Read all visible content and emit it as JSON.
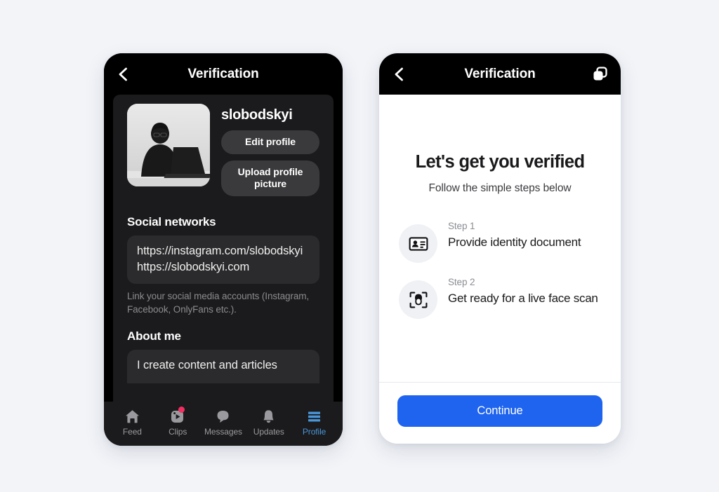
{
  "canvas": {
    "background_color": "#f2f4f8"
  },
  "profile_screen": {
    "name": "profile-verification-screen",
    "topbar": {
      "back_icon": "chevron-left-icon",
      "title": "Verification"
    },
    "profile": {
      "avatar_icon": "user-photo-avatar",
      "username": "slobodskyi",
      "buttons": [
        {
          "label": "Edit profile",
          "name": "edit-profile-button"
        },
        {
          "label": "Upload profile picture",
          "name": "upload-profile-picture-button"
        }
      ]
    },
    "social": {
      "heading": "Social networks",
      "value_lines": [
        "https://instagram.com/slobodskyi",
        "https://slobodskyi.com"
      ],
      "helper_text": "Link your social media accounts (Instagram, Facebook, OnlyFans etc.)."
    },
    "about": {
      "heading": "About me",
      "value": "I create content and articles"
    },
    "bottom_nav": {
      "active_color": "#4a96d8",
      "inactive_color": "#9a9a9e",
      "badge_color": "#f22f62",
      "items": [
        {
          "label": "Feed",
          "icon": "home-icon",
          "active": false,
          "badge": false
        },
        {
          "label": "Clips",
          "icon": "clips-play-icon",
          "active": false,
          "badge": true
        },
        {
          "label": "Messages",
          "icon": "chat-bubble-icon",
          "active": false,
          "badge": false
        },
        {
          "label": "Updates",
          "icon": "bell-icon",
          "active": false,
          "badge": false
        },
        {
          "label": "Profile",
          "icon": "menu-lines-icon",
          "active": true,
          "badge": false
        }
      ]
    }
  },
  "verification_screen": {
    "name": "verification-intro-screen",
    "topbar": {
      "back_icon": "chevron-left-icon",
      "title": "Verification",
      "action_icon": "copy-duplicate-icon"
    },
    "heading": "Let's get you verified",
    "subheading": "Follow the simple steps below",
    "steps": [
      {
        "label": "Step 1",
        "title": "Provide identity document",
        "icon": "id-card-icon"
      },
      {
        "label": "Step 2",
        "title": "Get ready for a live face scan",
        "icon": "face-scan-icon"
      }
    ],
    "cta": {
      "label": "Continue",
      "color": "#1f64ef"
    }
  }
}
